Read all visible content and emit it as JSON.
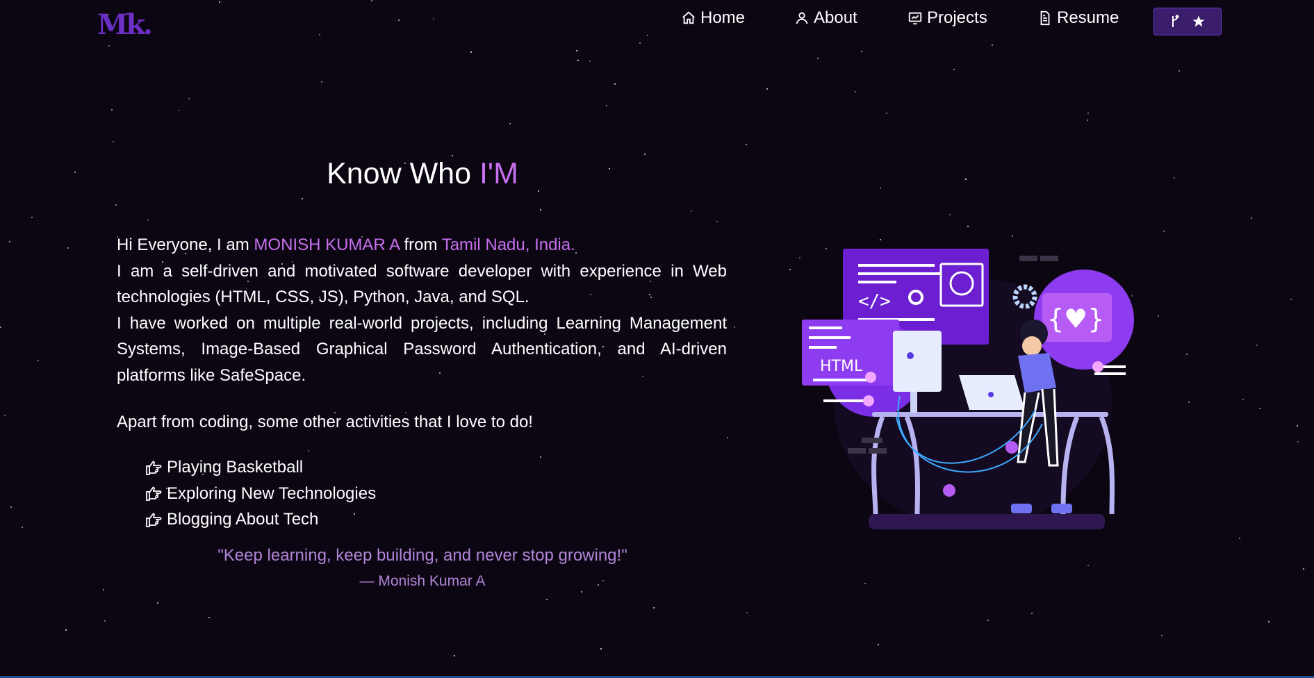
{
  "brand": {
    "logo_text": "Mk",
    "logo_dot": "."
  },
  "nav": {
    "items": [
      {
        "label": "Home",
        "icon": "home-icon"
      },
      {
        "label": "About",
        "icon": "user-icon"
      },
      {
        "label": "Projects",
        "icon": "chart-board-icon"
      },
      {
        "label": "Resume",
        "icon": "document-icon"
      }
    ],
    "github_button": {
      "icons": [
        "git-fork-icon",
        "star-icon"
      ]
    }
  },
  "about": {
    "heading_plain": "Know Who ",
    "heading_accent": "I'M",
    "intro_prefix": "Hi Everyone, I am ",
    "name": "MONISH KUMAR A",
    "intro_from": " from ",
    "location": "Tamil Nadu, India.",
    "paragraph_1": "I am a self-driven and motivated software developer with experience in Web technologies (HTML, CSS, JS), Python, Java, and SQL.",
    "paragraph_2": "I have worked on multiple real-world projects, including Learning Management Systems, Image-Based Graphical Password Authentication, and AI-driven platforms like SafeSpace.",
    "activities_intro": "Apart from coding, some other activities that I love to do!",
    "activities": [
      "Playing Basketball",
      "Exploring New Technologies",
      "Blogging About Tech"
    ],
    "quote": "\"Keep learning, keep building, and never stop growing!\"",
    "quote_author": "— Monish Kumar A"
  },
  "illustration": {
    "html_label": "HTML",
    "code_label": "</>",
    "heart_label": "{♥}"
  },
  "colors": {
    "background": "#0c0613",
    "accent": "#c770f0",
    "logo": "#6b2fc4",
    "quote": "#b286d8",
    "button_bg": "#3a1d6b"
  }
}
